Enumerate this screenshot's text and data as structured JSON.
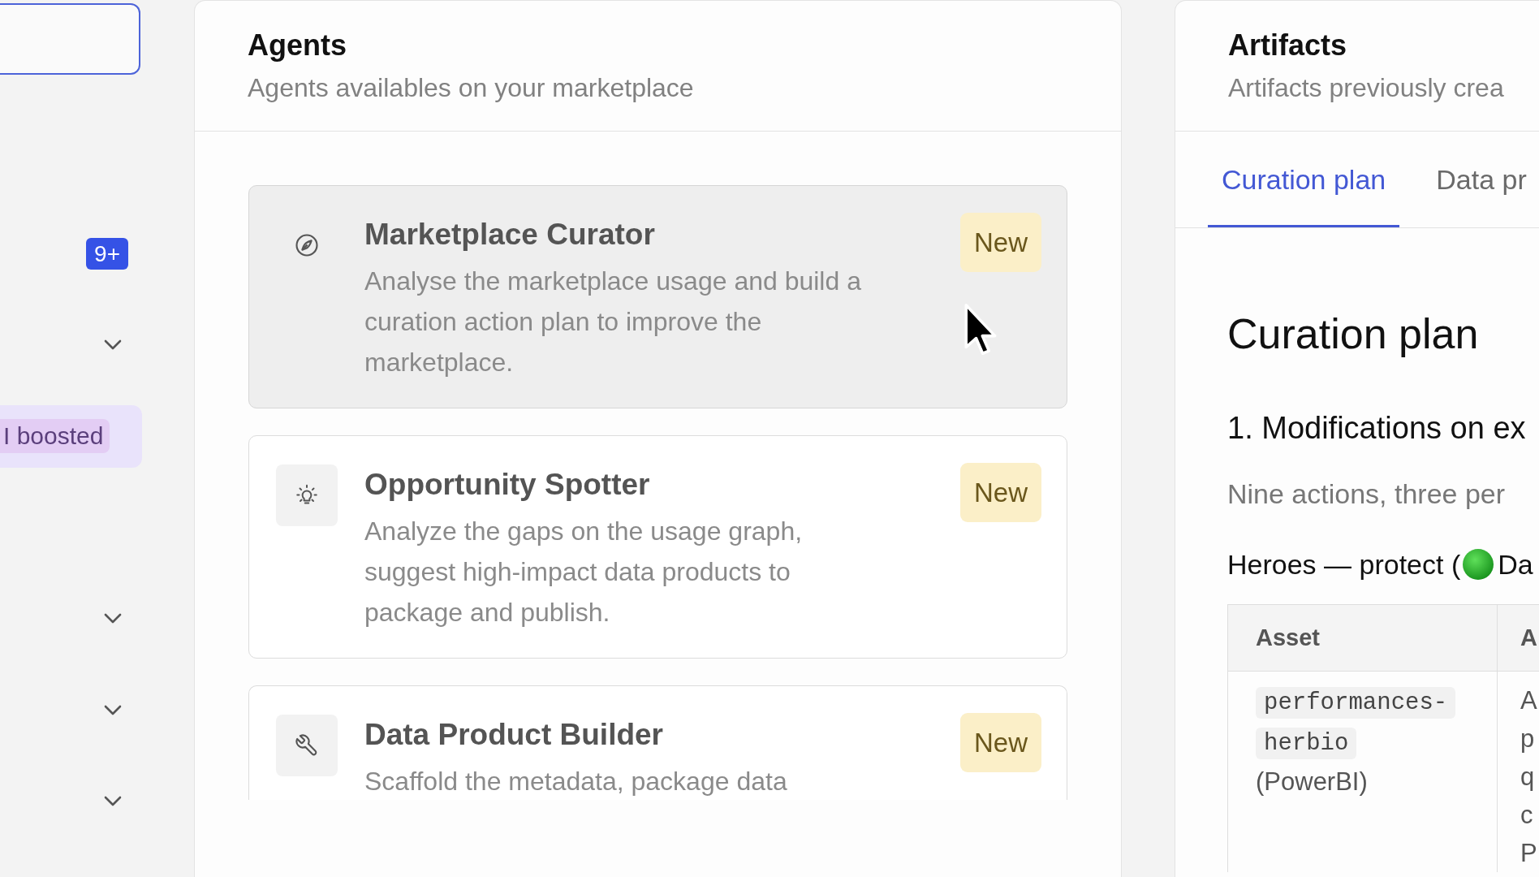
{
  "sidebar": {
    "input": {
      "focused": true
    },
    "items": [
      {
        "kind": "count",
        "count": "9+",
        "selected": false
      },
      {
        "kind": "group",
        "expanded": false,
        "selected": false
      },
      {
        "kind": "tag",
        "tag": "I boosted",
        "selected": true
      },
      {
        "kind": "group",
        "expanded": false,
        "selected": false
      },
      {
        "kind": "group",
        "expanded": false,
        "selected": false
      },
      {
        "kind": "group",
        "expanded": false,
        "selected": false
      }
    ]
  },
  "agents_panel": {
    "title": "Agents",
    "subtitle": "Agents availables on your marketplace",
    "agents": [
      {
        "name": "Marketplace Curator",
        "description": "Analyse the marketplace usage and build a curation action plan to improve the marketplace.",
        "badge": "New",
        "hovered": true
      },
      {
        "name": "Opportunity Spotter",
        "description": "Analyze the gaps on the usage graph, suggest high-impact data products to package and publish.",
        "badge": "New",
        "hovered": false
      },
      {
        "name": "Data Product Builder",
        "description": "Scaffold the metadata, package data",
        "badge": "New",
        "hovered": false
      }
    ]
  },
  "artifacts_panel": {
    "title": "Artifacts",
    "subtitle": "Artifacts previously crea",
    "tabs": [
      {
        "label": "Curation plan",
        "selected": true
      },
      {
        "label": "Data pr",
        "selected": false
      }
    ],
    "document": {
      "heading": "Curation plan",
      "section": "1. Modifications on ex",
      "intro": "Nine actions, three per",
      "heroes": {
        "before": "Heroes — protect (",
        "after": "Da"
      },
      "table": {
        "columns": [
          "Asset",
          "A"
        ],
        "rows": [
          {
            "asset": {
              "code": "performances-herbio",
              "source": "(PowerBI)"
            },
            "column_2": [
              "A",
              "p",
              "q",
              "c",
              "P"
            ]
          }
        ]
      }
    }
  }
}
